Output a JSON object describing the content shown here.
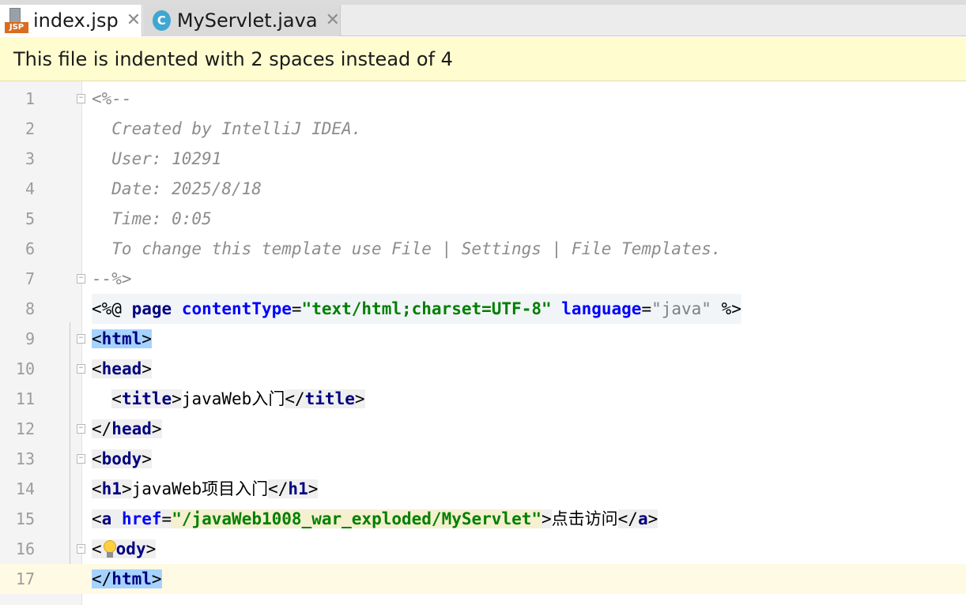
{
  "tabs": [
    {
      "icon": "jsp-file-icon",
      "icon_badge": "JSP",
      "label": "index.jsp",
      "active": true
    },
    {
      "icon": "java-class-icon",
      "icon_letter": "C",
      "label": "MyServlet.java",
      "active": false
    }
  ],
  "notification": {
    "text": "This file is indented with 2 spaces instead of 4"
  },
  "editor": {
    "current_line": 17,
    "lines": [
      {
        "number": "1",
        "tokens": [
          "<%--"
        ]
      },
      {
        "number": "2",
        "tokens": [
          "  Created by IntelliJ IDEA."
        ]
      },
      {
        "number": "3",
        "tokens": [
          "  User: 10291"
        ]
      },
      {
        "number": "4",
        "tokens": [
          "  Date: 2025/8/18"
        ]
      },
      {
        "number": "5",
        "tokens": [
          "  Time: 0:05"
        ]
      },
      {
        "number": "6",
        "tokens": [
          "  To change this template use File | Settings | File Templates."
        ]
      },
      {
        "number": "7",
        "tokens": [
          "--%>"
        ]
      },
      {
        "number": "8",
        "tokens": [
          "<%@ ",
          "page",
          " ",
          "contentType",
          "=",
          "\"text/html;charset=UTF-8\"",
          " ",
          "language",
          "=",
          "\"java\"",
          " %>"
        ]
      },
      {
        "number": "9",
        "tokens": [
          "<",
          "html",
          ">"
        ]
      },
      {
        "number": "10",
        "tokens": [
          "<",
          "head",
          ">"
        ]
      },
      {
        "number": "11",
        "tokens": [
          "  ",
          "<",
          "title",
          ">",
          "javaWeb入门",
          "</",
          "title",
          ">"
        ]
      },
      {
        "number": "12",
        "tokens": [
          "</",
          "head",
          ">"
        ]
      },
      {
        "number": "13",
        "tokens": [
          "<",
          "body",
          ">"
        ]
      },
      {
        "number": "14",
        "tokens": [
          "<",
          "h1",
          ">",
          "javaWeb项目入门",
          "</",
          "h1",
          ">"
        ]
      },
      {
        "number": "15",
        "tokens": [
          "<",
          "a",
          " ",
          "href",
          "=",
          "\"/javaWeb1008_war_exploded/MyServlet\"",
          ">",
          "点击访问",
          "</",
          "a",
          ">"
        ]
      },
      {
        "number": "16",
        "tokens": [
          "<",
          "ody",
          ">"
        ]
      },
      {
        "number": "17",
        "tokens": [
          "</",
          "html",
          ">"
        ]
      }
    ]
  }
}
